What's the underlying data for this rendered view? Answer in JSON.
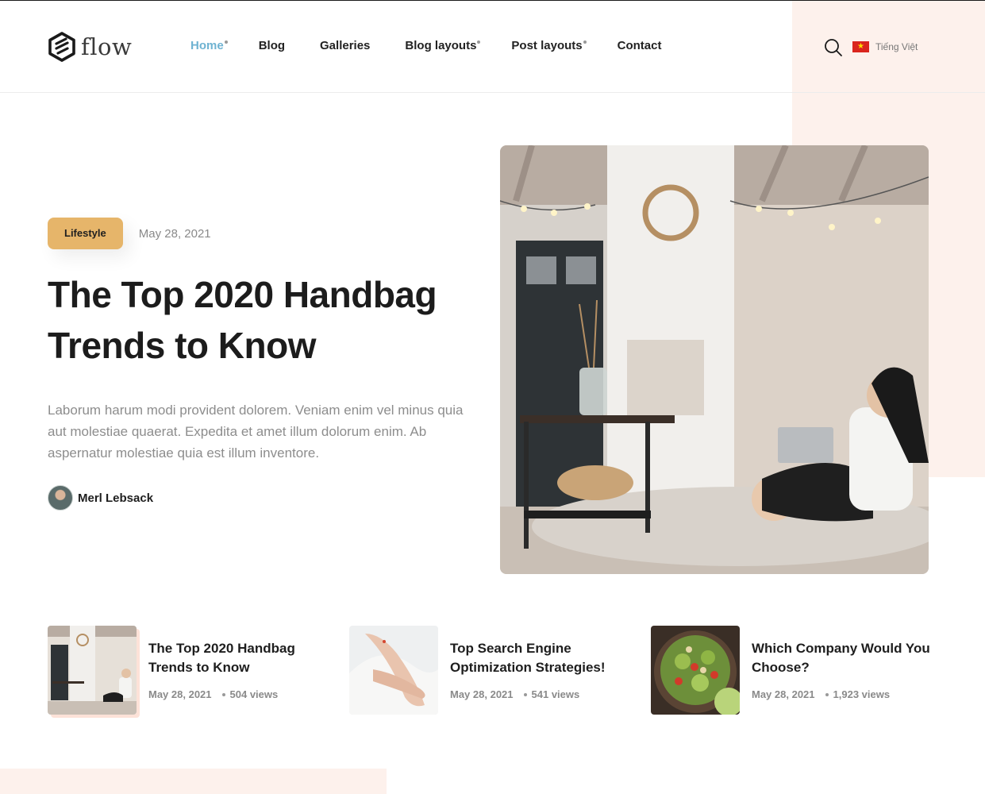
{
  "brand": {
    "name": "flow"
  },
  "nav": {
    "items": [
      {
        "label": "Home",
        "active": true,
        "has_submenu": true
      },
      {
        "label": "Blog",
        "active": false,
        "has_submenu": false
      },
      {
        "label": "Galleries",
        "active": false,
        "has_submenu": false
      },
      {
        "label": "Blog layouts",
        "active": false,
        "has_submenu": true
      },
      {
        "label": "Post layouts",
        "active": false,
        "has_submenu": true
      },
      {
        "label": "Contact",
        "active": false,
        "has_submenu": false
      }
    ]
  },
  "header": {
    "search_icon": "search-icon",
    "language": {
      "label": "Tiếng Việt",
      "flag": "vietnam-flag-icon"
    }
  },
  "hero": {
    "category": "Lifestyle",
    "date": "May 28, 2021",
    "title_line1": "The Top 2020 Handbag",
    "title_line2": "Trends to Know",
    "excerpt_line1": "Laborum harum modi provident dolorem. Veniam enim vel minus quia",
    "excerpt_line2": "aut molestiae quaerat. Expedita et amet illum dolorum enim. Ab",
    "excerpt_line3": "aspernatur molestiae quia est illum inventore.",
    "author": "Merl Lebsack"
  },
  "posts": [
    {
      "title_line1": "The Top 2020 Handbag",
      "title_line2": "Trends to Know",
      "date": "May 28, 2021",
      "views": "504 views"
    },
    {
      "title_line1": "Top Search Engine",
      "title_line2": "Optimization Strategies!",
      "date": "May 28, 2021",
      "views": "541 views"
    },
    {
      "title_line1": "Which Company Would You",
      "title_line2": "Choose?",
      "date": "May 28, 2021",
      "views": "1,923 views"
    }
  ],
  "colors": {
    "accent_link": "#6fb3d2",
    "badge": "#e6b56a",
    "peach": "#fdf1ec",
    "text_dark": "#1c1c1c",
    "text_muted": "#8d8d8d"
  }
}
